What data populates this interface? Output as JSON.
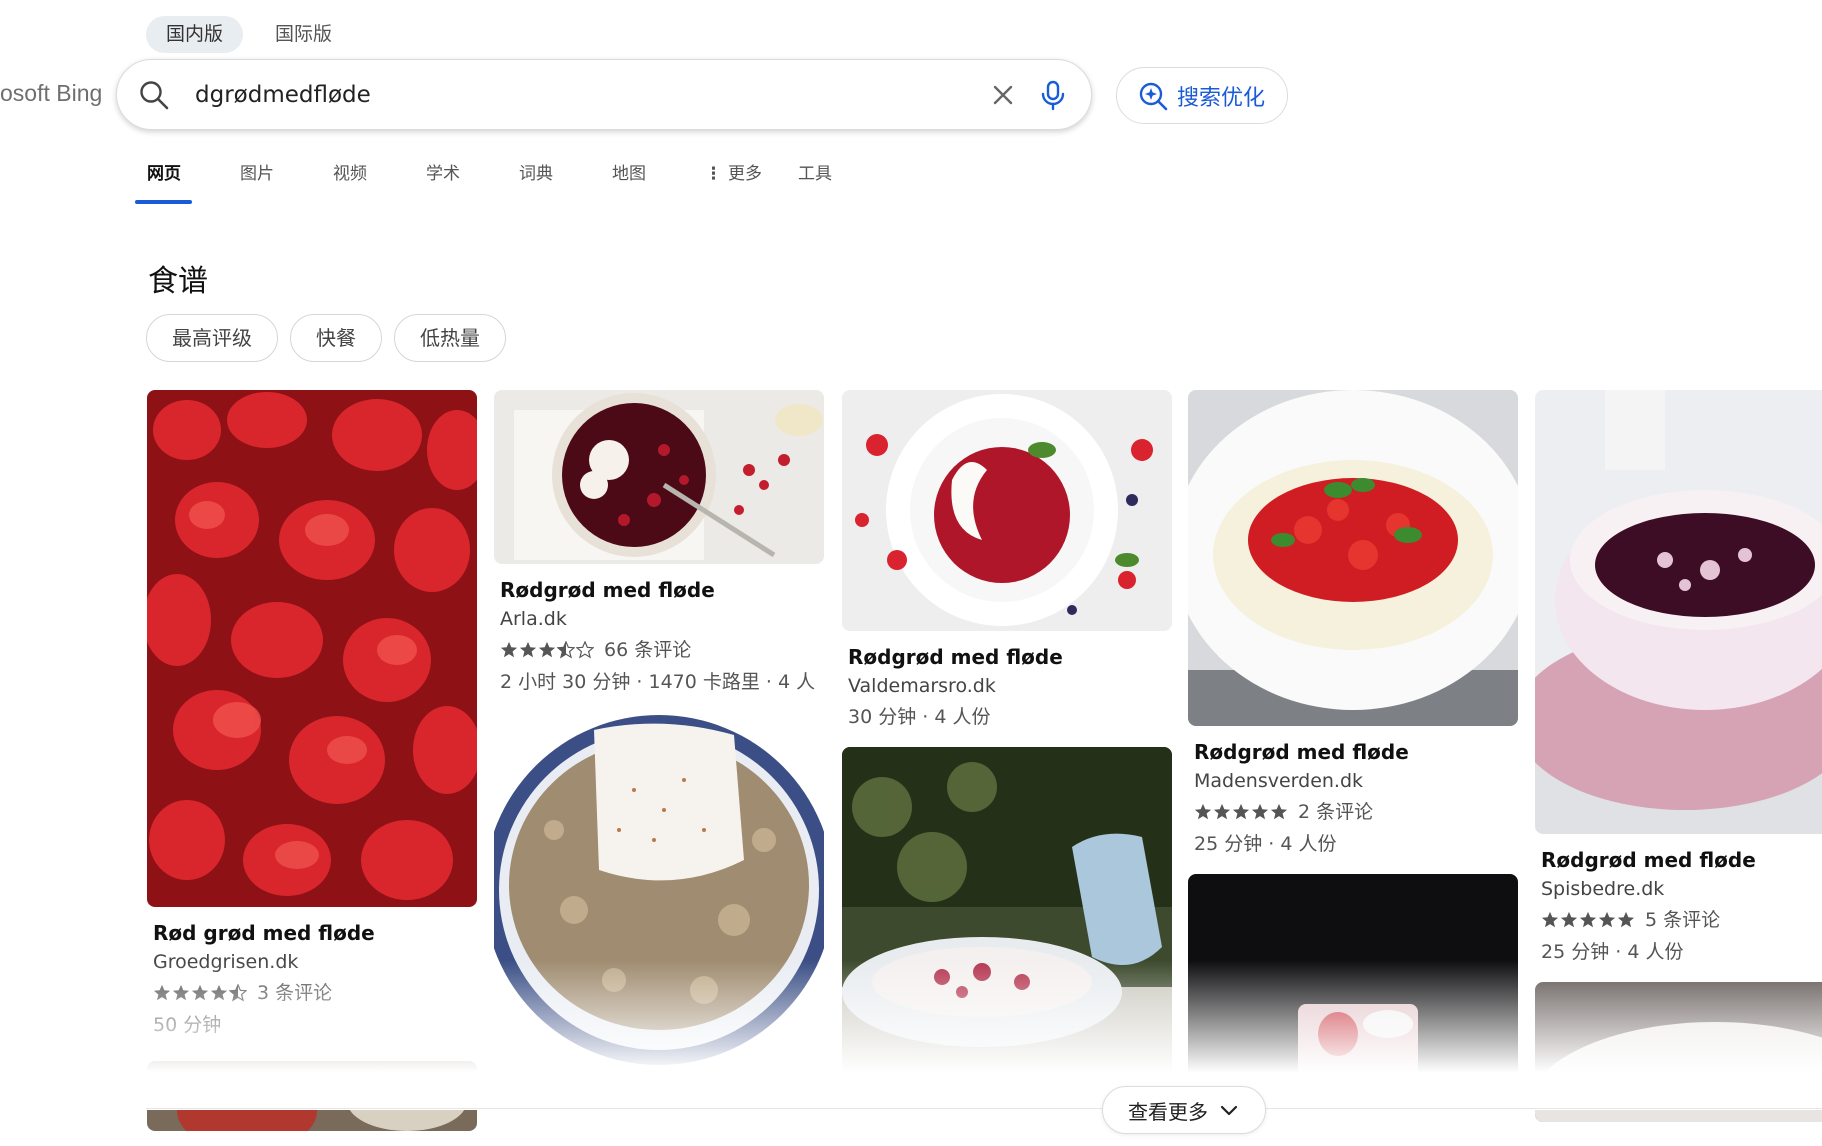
{
  "region_tabs": [
    {
      "label": "国内版",
      "active": true
    },
    {
      "label": "国际版",
      "active": false
    }
  ],
  "logo": {
    "text": "osoft Bing"
  },
  "search": {
    "query": "dgrødmedfløde",
    "placeholder": ""
  },
  "optimize": {
    "label": "搜索优化"
  },
  "scopes": {
    "web": "网页",
    "images": "图片",
    "videos": "视频",
    "academic": "学术",
    "dictionary": "词典",
    "maps": "地图",
    "more": "更多",
    "tools": "工具"
  },
  "recipes": {
    "title": "食谱",
    "filters": [
      "最高评级",
      "快餐",
      "低热量"
    ],
    "cards": [
      {
        "title": "Rød grød med fløde",
        "source": "Groedgrisen.dk",
        "rating": 4.5,
        "reviews": "3 条评论",
        "info": "50 分钟"
      },
      {
        "title": "Rødgrød med fløde",
        "source": "Arla.dk",
        "rating": 3.5,
        "reviews": "66 条评论",
        "info": "2 小时 30 分钟 · 1470 卡路里 · 4 人"
      },
      {
        "title": "Rødgrød med fløde",
        "source": "Valdemarsro.dk",
        "info": "30 分钟 · 4 人份"
      },
      {
        "title": "Rødgrød med fløde",
        "source": "Madensverden.dk",
        "rating": 5,
        "reviews": "2 条评论",
        "info": "25 分钟 · 4 人份"
      },
      {
        "title": "Rødgrød med fløde",
        "source": "Spisbedre.dk",
        "rating": 5,
        "reviews": "5 条评论",
        "info": "25 分钟 · 4 人份"
      }
    ]
  },
  "more_button": {
    "label": "查看更多"
  },
  "colors": {
    "accent": "#1a5bd8",
    "star": "#555555"
  }
}
